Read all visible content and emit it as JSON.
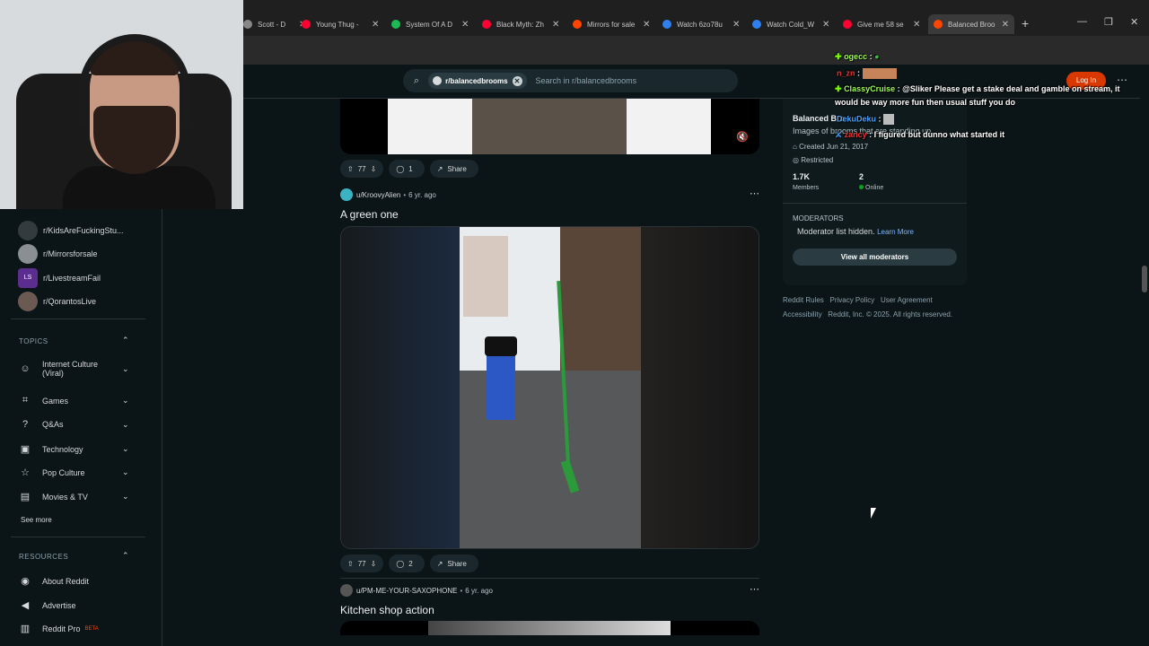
{
  "browser": {
    "tabs": [
      {
        "title": "Scott - D",
        "color": "#888888"
      },
      {
        "title": "Young Thug - ",
        "color": "#ff0033"
      },
      {
        "title": "System Of A D",
        "color": "#1db954"
      },
      {
        "title": "Black Myth: Zh",
        "color": "#ff0033"
      },
      {
        "title": "Mirrors for sale",
        "color": "#ff4500"
      },
      {
        "title": "Watch 6zo78u",
        "color": "#2f80ed"
      },
      {
        "title": "Watch Cold_W",
        "color": "#2f80ed"
      },
      {
        "title": "Give me 58 se",
        "color": "#ff0033"
      },
      {
        "title": "Balanced Broo",
        "color": "#ff4500"
      }
    ],
    "new_tab": "+"
  },
  "header": {
    "subreddit_chip": "r/balancedbrooms",
    "search_placeholder": "Search in r/balancedbrooms",
    "login_label": "Log In"
  },
  "sidebar": {
    "communities": [
      {
        "name": "r/KidsAreFuckingStu...",
        "color": "#333b3e"
      },
      {
        "name": "r/Mirrorsforsale",
        "color": "#8a8f91"
      },
      {
        "name": "r/LivestreamFail",
        "color": "#5b2d8e",
        "abbr": "LS"
      },
      {
        "name": "r/QorantosLive",
        "color": "#6b5a52"
      }
    ],
    "topics_heading": "TOPICS",
    "topics": [
      {
        "label": "Internet Culture",
        "label2": "(Viral)"
      },
      {
        "label": "Games"
      },
      {
        "label": "Q&As"
      },
      {
        "label": "Technology"
      },
      {
        "label": "Pop Culture"
      },
      {
        "label": "Movies & TV"
      }
    ],
    "see_more": "See more",
    "resources_heading": "RESOURCES",
    "resources": [
      {
        "label": "About Reddit"
      },
      {
        "label": "Advertise"
      },
      {
        "label": "Reddit Pro",
        "badge": "BETA"
      }
    ]
  },
  "feed": {
    "posts": [
      {
        "votes": "77",
        "comments": "1",
        "share": "Share"
      },
      {
        "user": "u/KroovyAlien",
        "age": "6 yr. ago",
        "title": "A green one",
        "votes": "77",
        "comments": "2",
        "share": "Share"
      },
      {
        "user": "u/PM-ME-YOUR-SAXOPHONE",
        "age": "6 yr. ago",
        "title": "Kitchen shop action"
      }
    ]
  },
  "community_card": {
    "name": "Balanced Bro",
    "description": "Images of brooms that are standing up.",
    "created": "Created Jun 21, 2017",
    "status": "Restricted",
    "members_count": "1.7K",
    "members_label": "Members",
    "online_count": "2",
    "online_label": "Online",
    "moderators_heading": "MODERATORS",
    "moderators_note": "Moderator list hidden.",
    "learn_more": "Learn More",
    "view_all": "View all moderators"
  },
  "footer": {
    "row1": [
      "Reddit Rules",
      "Privacy Policy",
      "User Agreement"
    ],
    "row2": [
      "Accessibility",
      "Reddit, Inc. © 2025. All rights reserved."
    ]
  },
  "chat": [
    {
      "user": "ogecc",
      "text": ""
    },
    {
      "user": "n_zn",
      "text": ""
    },
    {
      "user": "ClassyCruise",
      "text": "@Sliker Please get a stake deal and gamble on stream, it"
    },
    {
      "user": "",
      "text": "would be way more fun then usual stuff you do"
    },
    {
      "user": "DekuDeku",
      "text": ""
    },
    {
      "user": "zancy",
      "text": "I figured but dunno what started it"
    }
  ]
}
